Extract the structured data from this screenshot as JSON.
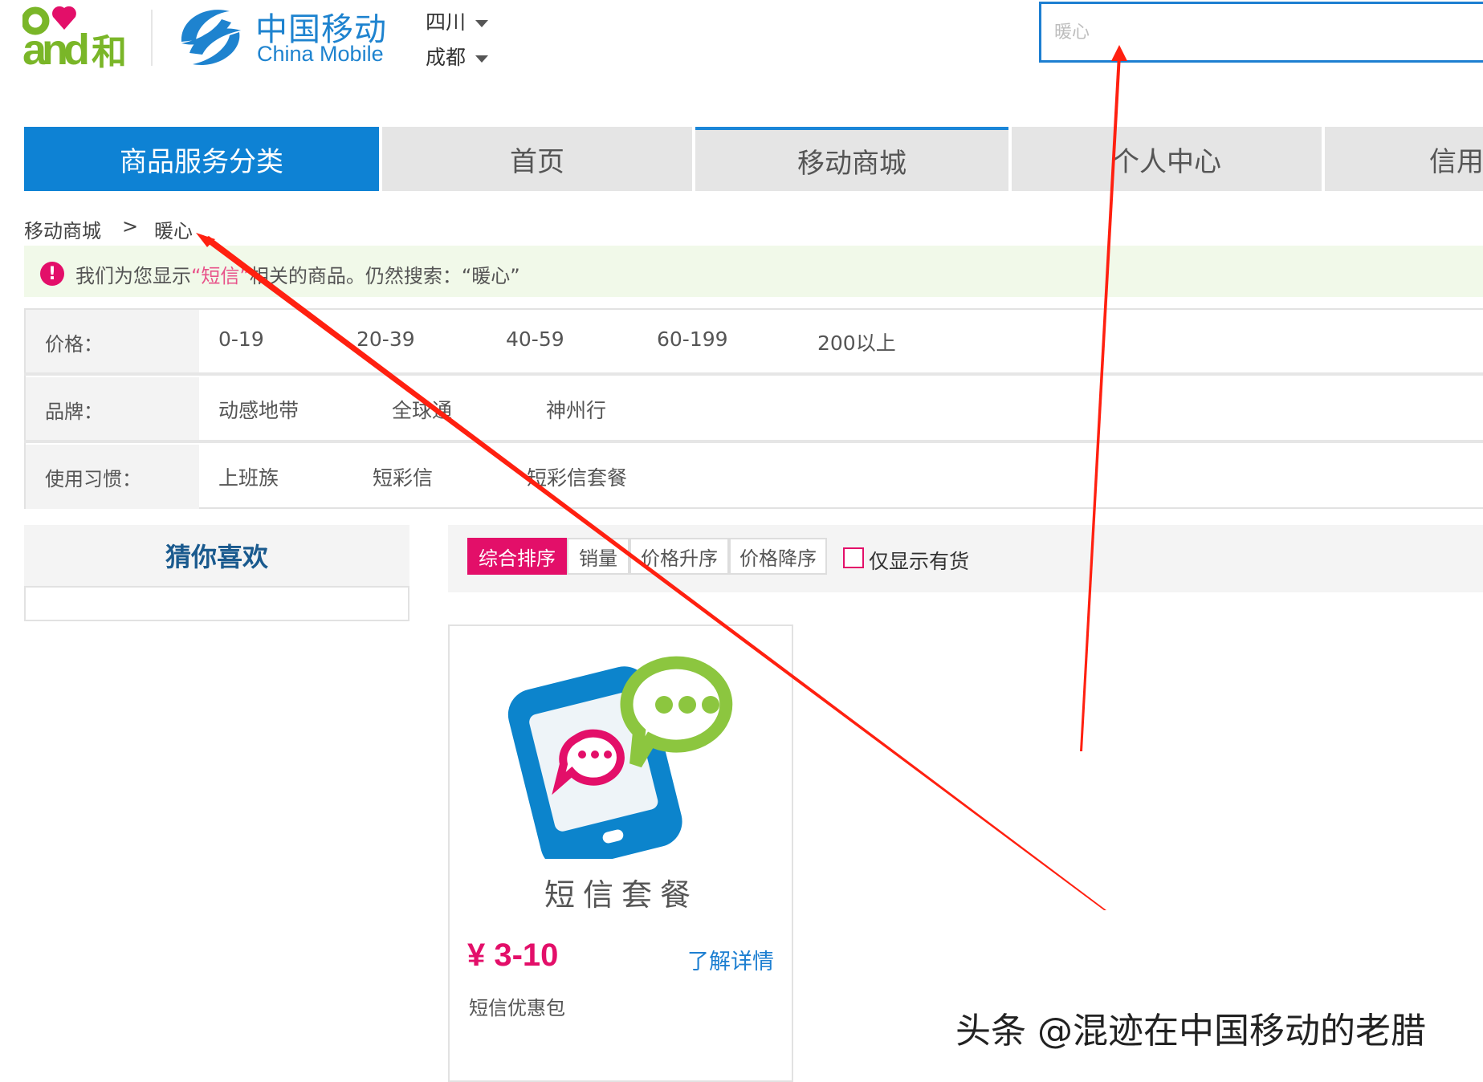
{
  "header": {
    "brand_and": "and",
    "brand_he": "和",
    "logo_cn": "中国移动",
    "logo_en": "China Mobile",
    "province": "四川",
    "city": "成都",
    "search_placeholder": "暖心"
  },
  "nav": {
    "category": "商品服务分类",
    "home": "首页",
    "mall": "移动商城",
    "personal": "个人中心",
    "credit": "信用"
  },
  "breadcrumb": {
    "root": "移动商城",
    "separator": ">",
    "current": "暖心"
  },
  "notice": {
    "icon": "!",
    "prefix": "我们为您显示",
    "highlight": "“短信”",
    "middle": "相关的商品。仍然搜索：",
    "original": "“暖心”"
  },
  "filters": {
    "price": {
      "label": "价格：",
      "options": [
        "0-19",
        "20-39",
        "40-59",
        "60-199",
        "200以上"
      ]
    },
    "brand": {
      "label": "品牌：",
      "options": [
        "动感地带",
        "全球通",
        "神州行"
      ]
    },
    "habit": {
      "label": "使用习惯：",
      "options": [
        "上班族",
        "短彩信",
        "短彩信套餐"
      ]
    }
  },
  "sidebar": {
    "guess_title": "猜你喜欢"
  },
  "sort": {
    "options": [
      "综合排序",
      "销量",
      "价格升序",
      "价格降序"
    ],
    "active_index": 0,
    "in_stock_label": "仅显示有货",
    "in_stock_checked": false
  },
  "product": {
    "image_caption": "短信套餐",
    "price": "¥ 3-10",
    "detail_link": "了解详情",
    "subtitle": "短信优惠包"
  },
  "watermark": "头条 @混迹在中国移动的老腊",
  "colors": {
    "brand_blue": "#0e82d4",
    "accent_pink": "#e30f69",
    "link_blue": "#1d7fd1",
    "notice_bg": "#f1f9e9",
    "logo_green": "#7ab628",
    "annotation_red": "#ff2010"
  }
}
